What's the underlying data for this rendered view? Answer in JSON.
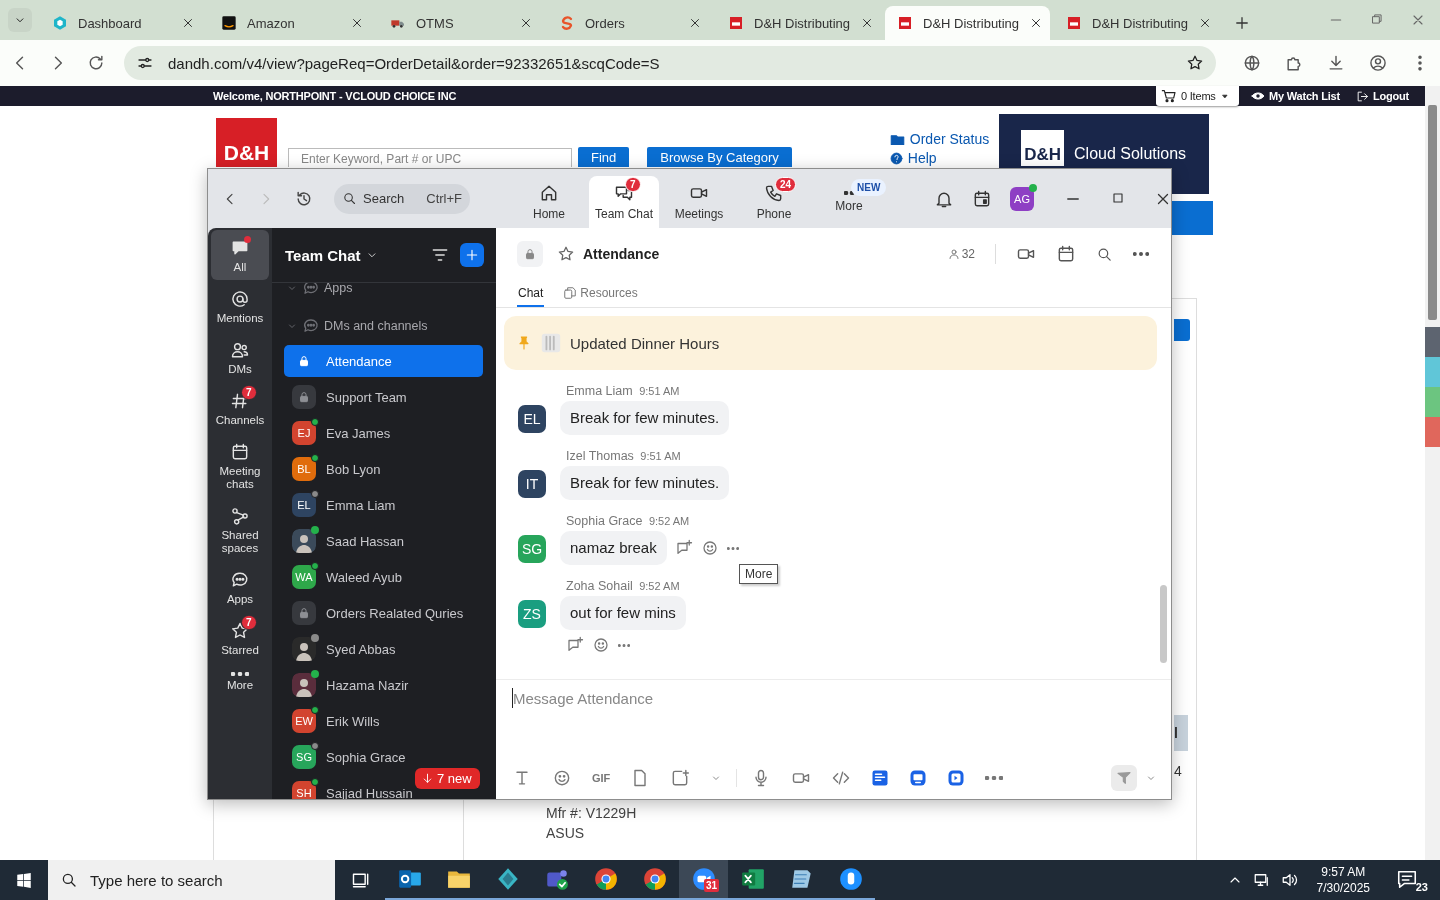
{
  "browser": {
    "tabs": [
      {
        "title": "Dashboard",
        "selected": false
      },
      {
        "title": "Amazon",
        "selected": false
      },
      {
        "title": "OTMS",
        "selected": false
      },
      {
        "title": "Orders",
        "selected": false
      },
      {
        "title": "D&H Distributing",
        "selected": false
      },
      {
        "title": "D&H Distributing",
        "selected": true
      },
      {
        "title": "D&H Distributing",
        "selected": false
      }
    ],
    "url": "dandh.com/v4/view?pageReq=OrderDetail&order=92332651&scqCode=S"
  },
  "site": {
    "welcome": "Welcome, NORTHPOINT - VCLOUD CHOICE INC",
    "cart": "0 Items",
    "watch_list": "My Watch List",
    "logout": "Logout",
    "logo": "D&H",
    "search_placeholder": "Enter Keyword, Part # or UPC",
    "find": "Find",
    "browse": "Browse By Category",
    "order_status": "Order Status",
    "help": "Help",
    "banner_logo": "D&H",
    "banner": "Cloud Solutions",
    "side_texts": [
      "l",
      "4"
    ],
    "product": {
      "mfr": "Mfr #: V1229H",
      "brand": "ASUS"
    }
  },
  "zoom": {
    "search": "Search",
    "shortcut": "Ctrl+F",
    "tabs": [
      {
        "label": "Home",
        "selected": false
      },
      {
        "label": "Team Chat",
        "badge": "7",
        "selected": true
      },
      {
        "label": "Meetings",
        "selected": false
      },
      {
        "label": "Phone",
        "badge": "24",
        "selected": false
      },
      {
        "label": "More",
        "tag": "NEW",
        "selected": false
      }
    ],
    "profile": {
      "initials": "AG",
      "online": true
    },
    "rail": [
      {
        "label": "All",
        "selected": true,
        "dot": true
      },
      {
        "label": "Mentions",
        "selected": false,
        "dot": false
      },
      {
        "label": "DMs",
        "selected": false,
        "dot": false
      },
      {
        "label": "Channels",
        "badge": "7",
        "selected": false,
        "dot": false
      },
      {
        "label": "Meeting chats",
        "selected": false,
        "dot": false
      },
      {
        "label": "Shared spaces",
        "selected": false,
        "dot": false
      },
      {
        "label": "Apps",
        "selected": false,
        "dot": false
      },
      {
        "label": "Starred",
        "badge": "7",
        "selected": false,
        "dot": false
      },
      {
        "label": "More",
        "selected": false,
        "dot": false
      }
    ],
    "list": {
      "title": "Team Chat",
      "sections": [
        {
          "label": "Apps",
          "expanded": true
        },
        {
          "label": "DMs and channels",
          "expanded": true
        }
      ],
      "items": [
        {
          "name": "Attendance",
          "kind": "channel",
          "selected": true
        },
        {
          "name": "Support Team",
          "kind": "channel",
          "selected": false
        },
        {
          "name": "Eva James",
          "kind": "person",
          "initials": "EJ",
          "color": "#d2442f",
          "online": true,
          "selected": false
        },
        {
          "name": "Bob Lyon",
          "kind": "person",
          "initials": "BL",
          "color": "#e06c0c",
          "online": true,
          "selected": false
        },
        {
          "name": "Emma Liam",
          "kind": "person",
          "initials": "EL",
          "color": "#2e4461",
          "online": false,
          "selected": false
        },
        {
          "name": "Saad Hassan",
          "kind": "photo",
          "color": "#3b4a5a",
          "online": true,
          "selected": false
        },
        {
          "name": "Waleed Ayub",
          "kind": "person",
          "initials": "WA",
          "color": "#2ea84a",
          "online": true,
          "selected": false
        },
        {
          "name": "Orders Realated Quries",
          "kind": "channel",
          "selected": false
        },
        {
          "name": "Syed Abbas",
          "kind": "photo",
          "color": "#2a2a2a",
          "online": false,
          "selected": false
        },
        {
          "name": "Hazama Nazir",
          "kind": "photo",
          "color": "#5a2d3c",
          "online": true,
          "selected": false
        },
        {
          "name": "Erik Wills",
          "kind": "person",
          "initials": "EW",
          "color": "#d2442f",
          "online": true,
          "selected": false
        },
        {
          "name": "Sophia Grace",
          "kind": "person",
          "initials": "SG",
          "color": "#27a55b",
          "online": false,
          "selected": false
        },
        {
          "name": "Sajjad Hussain",
          "kind": "person",
          "initials": "SH",
          "color": "#d2442f",
          "online": true,
          "selected": false
        }
      ],
      "new_badge": "7 new"
    },
    "chat": {
      "title": "Attendance",
      "members": "32",
      "tabs": [
        {
          "label": "Chat",
          "selected": true
        },
        {
          "label": "Resources",
          "selected": false
        }
      ],
      "pinned": "Updated Dinner Hours",
      "messages": [
        {
          "sender": "Emma Liam",
          "time": "9:51 AM",
          "initials": "EL",
          "color": "#2e4461",
          "text": "Break for few minutes.",
          "kind": "plain"
        },
        {
          "sender": "Izel Thomas",
          "time": "9:51 AM",
          "initials": "IT",
          "color": "#2e4461",
          "text": "Break for few minutes.",
          "kind": "plain"
        },
        {
          "sender": "Sophia Grace",
          "time": "9:52 AM",
          "initials": "SG",
          "color": "#27a55b",
          "text": "namaz break",
          "kind": "hover"
        },
        {
          "sender": "Zoha Sohail",
          "time": "9:52 AM",
          "initials": "ZS",
          "color": "#1a9e80",
          "text": "out for few mins",
          "kind": "actions"
        }
      ],
      "tooltip": "More",
      "composer_placeholder": "Message Attendance",
      "gif_label": "GIF"
    }
  },
  "taskbar": {
    "search_placeholder": "Type here to search",
    "apps": [
      {
        "active": false
      },
      {
        "active": false
      },
      {
        "active": false
      },
      {
        "active": false
      },
      {
        "active": false
      },
      {
        "active": false
      },
      {
        "active": true,
        "badge": "31"
      },
      {
        "active": false
      },
      {
        "active": false
      },
      {
        "active": false
      }
    ],
    "time": "9:57 AM",
    "date": "7/30/2025",
    "notifications": "23"
  }
}
